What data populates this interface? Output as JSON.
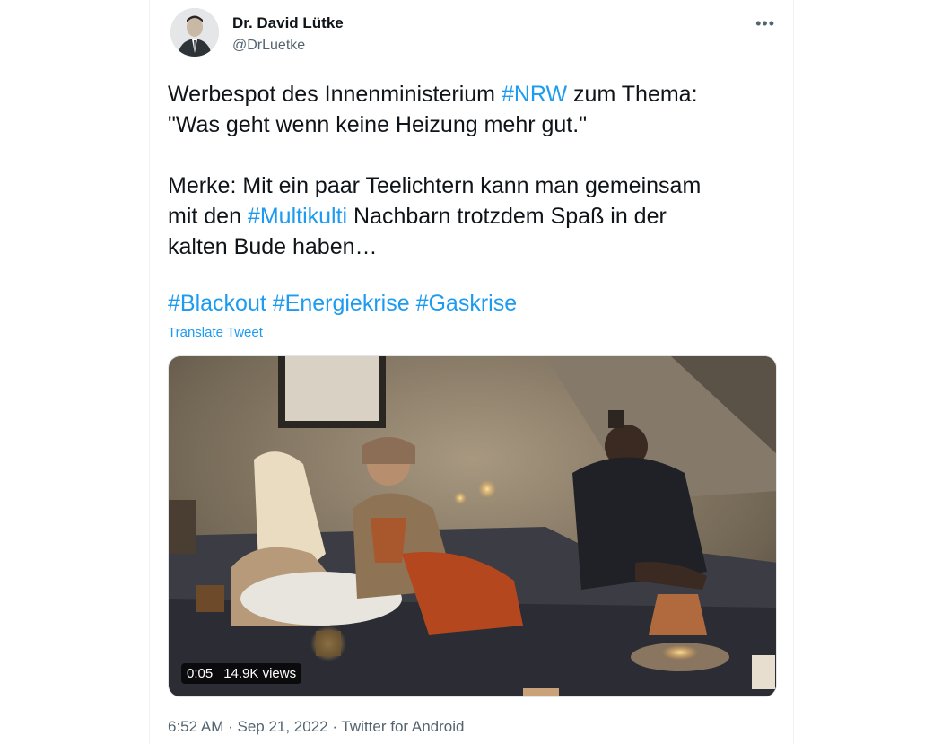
{
  "author": {
    "name": "Dr. David Lütke",
    "handle": "@DrLuetke"
  },
  "more_label": "•••",
  "tweet": {
    "line1_pre": "Werbespot des Innenministerium ",
    "line1_tag": "#NRW",
    "line1_post": " zum Thema:",
    "line2": "\"Was geht wenn keine Heizung mehr gut.\"",
    "line3": "Merke: Mit ein paar Teelichtern kann man gemeinsam",
    "line4_pre": "mit den ",
    "line4_tag": "#Multikulti",
    "line4_post": " Nachbarn trotzdem Spaß in der",
    "line5": "kalten Bude haben…",
    "hashtags": [
      "#Blackout",
      "#Energiekrise",
      "#Gaskrise"
    ]
  },
  "translate_label": "Translate Tweet",
  "video": {
    "duration": "0:05",
    "views": "14.9K views"
  },
  "meta": {
    "time": "6:52 AM",
    "date": "Sep 21, 2022",
    "source": "Twitter for Android",
    "separator": " · "
  },
  "colors": {
    "accent": "#1d9bf0",
    "secondary_text": "#536471"
  }
}
